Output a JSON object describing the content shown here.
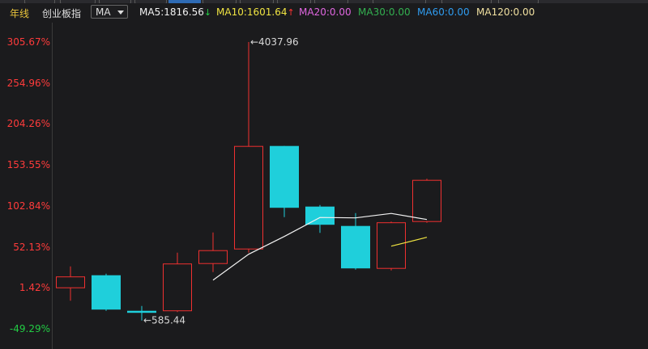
{
  "header": {
    "period": "年线",
    "index_name": "创业板指",
    "indicator_select": "MA",
    "ma": [
      {
        "label": "MA5:1816.56",
        "arrow": "↓",
        "color": "#f2f2f2",
        "arrow_color": "#22cc44"
      },
      {
        "label": "MA10:1601.64",
        "arrow": "↑",
        "color": "#f0e442",
        "arrow_color": "#ff3333"
      },
      {
        "label": "MA20:0.00",
        "arrow": "",
        "color": "#e066e0",
        "arrow_color": ""
      },
      {
        "label": "MA30:0.00",
        "arrow": "",
        "color": "#33b050",
        "arrow_color": ""
      },
      {
        "label": "MA60:0.00",
        "arrow": "",
        "color": "#2f9cf0",
        "arrow_color": ""
      },
      {
        "label": "MA120:0.00",
        "arrow": "",
        "color": "#f0e0a0",
        "arrow_color": ""
      }
    ]
  },
  "chart_data": {
    "type": "candlestick",
    "y_axis_labels": [
      {
        "text": "305.67%",
        "value": 305.67,
        "color": "#ff3b3b"
      },
      {
        "text": "254.96%",
        "value": 254.96,
        "color": "#ff3b3b"
      },
      {
        "text": "204.26%",
        "value": 204.26,
        "color": "#ff3b3b"
      },
      {
        "text": "153.55%",
        "value": 153.55,
        "color": "#ff3b3b"
      },
      {
        "text": "102.84%",
        "value": 102.84,
        "color": "#ff3b3b"
      },
      {
        "text": "52.13%",
        "value": 52.13,
        "color": "#ff3b3b"
      },
      {
        "text": "1.42%",
        "value": 1.42,
        "color": "#ff3b3b"
      },
      {
        "text": "-49.29%",
        "value": -49.29,
        "color": "#22cc44"
      }
    ],
    "ylim": [
      -60,
      320
    ],
    "candles": [
      {
        "open": 1.0,
        "close": 15.5,
        "high": 28.0,
        "low": -14.5
      },
      {
        "open": 17.0,
        "close": -25.5,
        "high": 19.0,
        "low": -27.0
      },
      {
        "open": -27.0,
        "close": -29.5,
        "high": -21.0,
        "low": -39.0
      },
      {
        "open": -27.5,
        "close": 31.5,
        "high": 45.0,
        "low": -28.5
      },
      {
        "open": 31.0,
        "close": 48.0,
        "high": 70.0,
        "low": 21.0
      },
      {
        "open": 49.0,
        "close": 177.0,
        "high": 305.67,
        "low": 45.0
      },
      {
        "open": 177.0,
        "close": 100.5,
        "high": 177.0,
        "low": 89.0
      },
      {
        "open": 102.0,
        "close": 79.5,
        "high": 104.0,
        "low": 69.5
      },
      {
        "open": 78.0,
        "close": 25.5,
        "high": 94.0,
        "low": 24.0
      },
      {
        "open": 25.0,
        "close": 82.5,
        "high": 83.5,
        "low": 23.0
      },
      {
        "open": 83.0,
        "close": 135.0,
        "high": 136.5,
        "low": 82.0
      }
    ],
    "ma5_line": [
      null,
      null,
      null,
      null,
      11.0,
      43.0,
      65.0,
      88.5,
      88.0,
      93.5,
      86.0
    ],
    "ma10_line": [
      null,
      null,
      null,
      null,
      null,
      null,
      null,
      null,
      null,
      53.0,
      64.0
    ],
    "annotations": [
      {
        "text": "←4037.96",
        "candle": 5,
        "at": "high"
      },
      {
        "text": "←585.44",
        "candle": 2,
        "at": "low"
      }
    ],
    "colors": {
      "up": "#f03030",
      "down": "#1fcfdb",
      "ma5": "#f2f2f2",
      "ma10": "#f0e442"
    }
  }
}
